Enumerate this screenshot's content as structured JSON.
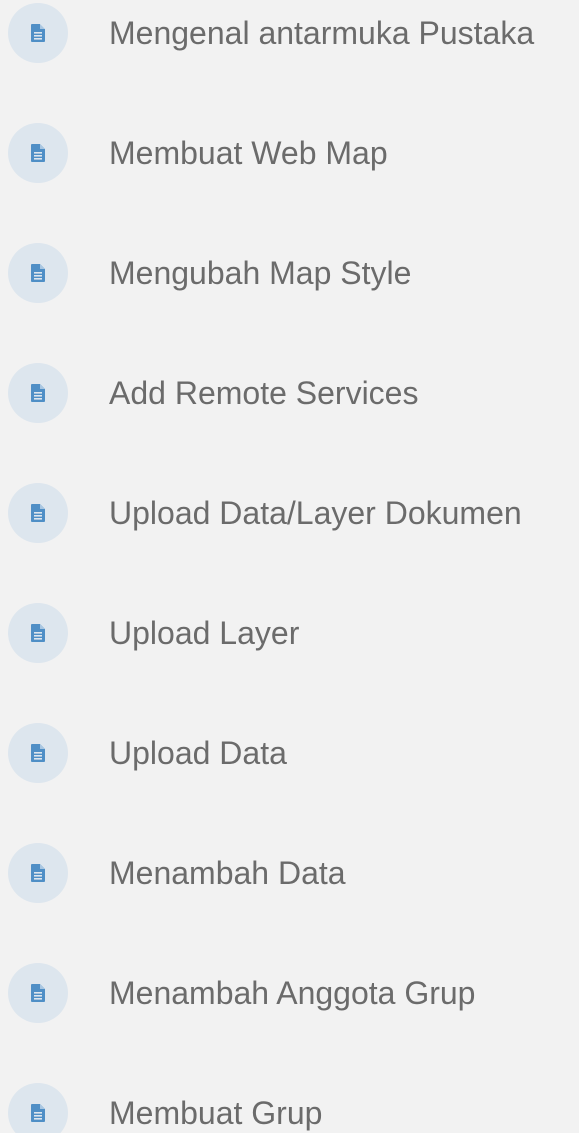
{
  "theme": {
    "background": "#f2f2f2",
    "icon_circle": "#dde6ee",
    "icon_color": "#4f8fc6",
    "text_color": "#6b6b6b"
  },
  "items": [
    {
      "label": "Mengenal antarmuka Pustaka",
      "icon": "document-icon"
    },
    {
      "label": "Membuat Web Map",
      "icon": "document-icon"
    },
    {
      "label": "Mengubah Map Style",
      "icon": "document-icon"
    },
    {
      "label": "Add Remote Services",
      "icon": "document-icon"
    },
    {
      "label": "Upload Data/Layer Dokumen",
      "icon": "document-icon"
    },
    {
      "label": "Upload Layer",
      "icon": "document-icon"
    },
    {
      "label": "Upload Data",
      "icon": "document-icon"
    },
    {
      "label": "Menambah Data",
      "icon": "document-icon"
    },
    {
      "label": "Menambah Anggota Grup",
      "icon": "document-icon"
    },
    {
      "label": "Membuat Grup",
      "icon": "document-icon"
    }
  ]
}
